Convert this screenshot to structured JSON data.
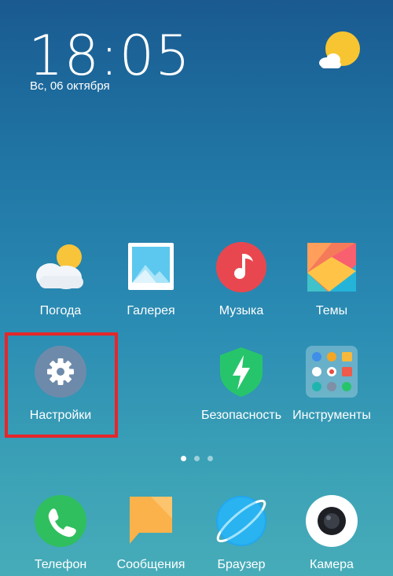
{
  "clock": {
    "time": "18:05",
    "date": "Вс, 06 октября"
  },
  "widget": {
    "icon": "weather-partly-cloudy-icon"
  },
  "apps_row1": [
    {
      "label": "Погода",
      "icon": "weather-icon"
    },
    {
      "label": "Галерея",
      "icon": "gallery-icon"
    },
    {
      "label": "Музыка",
      "icon": "music-icon"
    },
    {
      "label": "Темы",
      "icon": "themes-icon"
    }
  ],
  "apps_row2": [
    {
      "label": "Настройки",
      "icon": "gear-icon"
    },
    {
      "label": "Безопасность",
      "icon": "security-shield-icon"
    },
    {
      "label": "Инструменты",
      "icon": "tools-folder-icon"
    }
  ],
  "pager": {
    "pages": 3,
    "active": 1
  },
  "dock": [
    {
      "label": "Телефон",
      "icon": "phone-icon"
    },
    {
      "label": "Сообщения",
      "icon": "messages-icon"
    },
    {
      "label": "Браузер",
      "icon": "browser-icon"
    },
    {
      "label": "Камера",
      "icon": "camera-icon"
    }
  ],
  "colors": {
    "highlight": "#e5262a",
    "phone": "#2fbf5f",
    "music": "#e9474f",
    "security": "#27c56b",
    "settings": "#6e8aaa"
  }
}
